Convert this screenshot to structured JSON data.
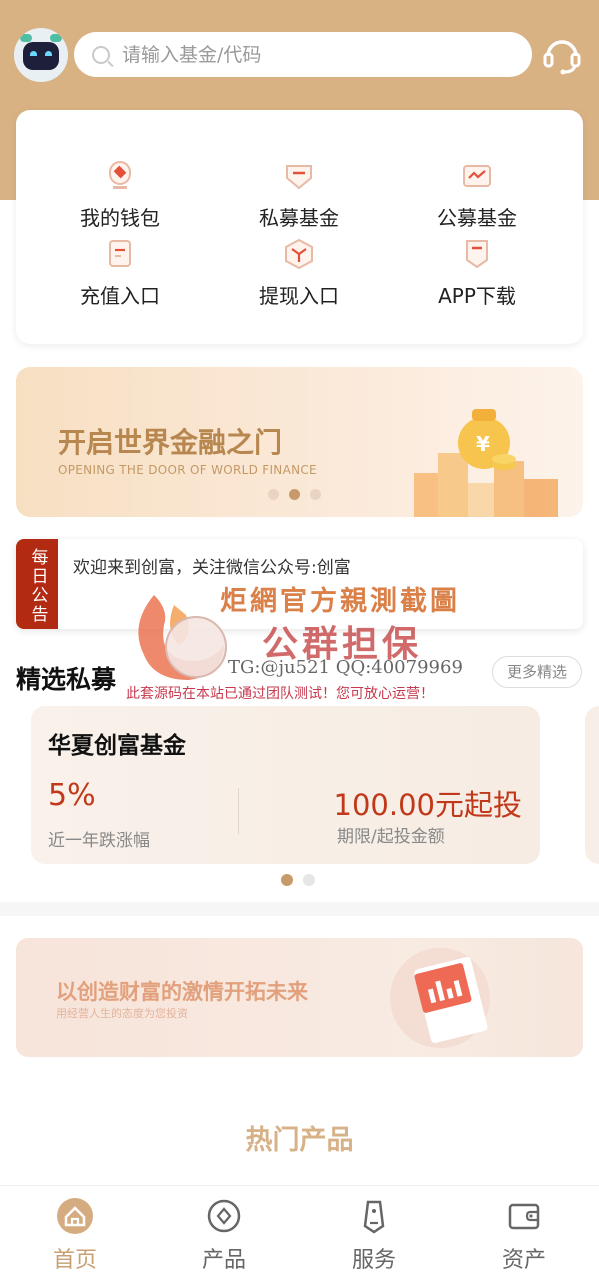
{
  "header": {
    "search_placeholder": "请输入基金/代码"
  },
  "quick_menu": [
    {
      "label": "我的钱包",
      "icon": "wallet-icon"
    },
    {
      "label": "私募基金",
      "icon": "private-fund-icon"
    },
    {
      "label": "公募基金",
      "icon": "public-fund-icon"
    },
    {
      "label": "充值入口",
      "icon": "recharge-icon"
    },
    {
      "label": "提现入口",
      "icon": "withdraw-icon"
    },
    {
      "label": "APP下载",
      "icon": "app-download-icon"
    }
  ],
  "banner": {
    "title": "开启世界金融之门",
    "subtitle": "OPENING THE DOOR OF WORLD FINANCE"
  },
  "notice": {
    "tag": "每日公告",
    "text": "欢迎来到创富，关注微信公众号:创富"
  },
  "watermark": {
    "line1": "炬網官方親測截圖",
    "line2": "公群担保",
    "line3": "TG:@ju521    QQ:40079969",
    "line4": "此套源码在本站已通过团队测试！您可放心运营！"
  },
  "private_section": {
    "title": "精选私募",
    "more_label": "更多精选",
    "fund": {
      "name": "华夏创富基金",
      "rate": "5%",
      "rate_label": "近一年跌涨幅",
      "min_invest": "100.00元起投",
      "min_invest_label": "期限/起投金额"
    }
  },
  "banner2": {
    "title": "以创造财富的激情开拓未来",
    "subtitle": "用经营人生的态度为您投资"
  },
  "hot_section": {
    "title": "热门产品"
  },
  "tabbar": [
    {
      "label": "首页",
      "icon": "home-icon",
      "active": true
    },
    {
      "label": "产品",
      "icon": "product-icon",
      "active": false
    },
    {
      "label": "服务",
      "icon": "service-icon",
      "active": false
    },
    {
      "label": "资产",
      "icon": "assets-wallet-icon",
      "active": false
    }
  ],
  "colors": {
    "header_bg": "#d9b284",
    "accent_gold": "#c8a071",
    "accent_red": "#c1391a",
    "notice_tag": "#b32a12"
  }
}
